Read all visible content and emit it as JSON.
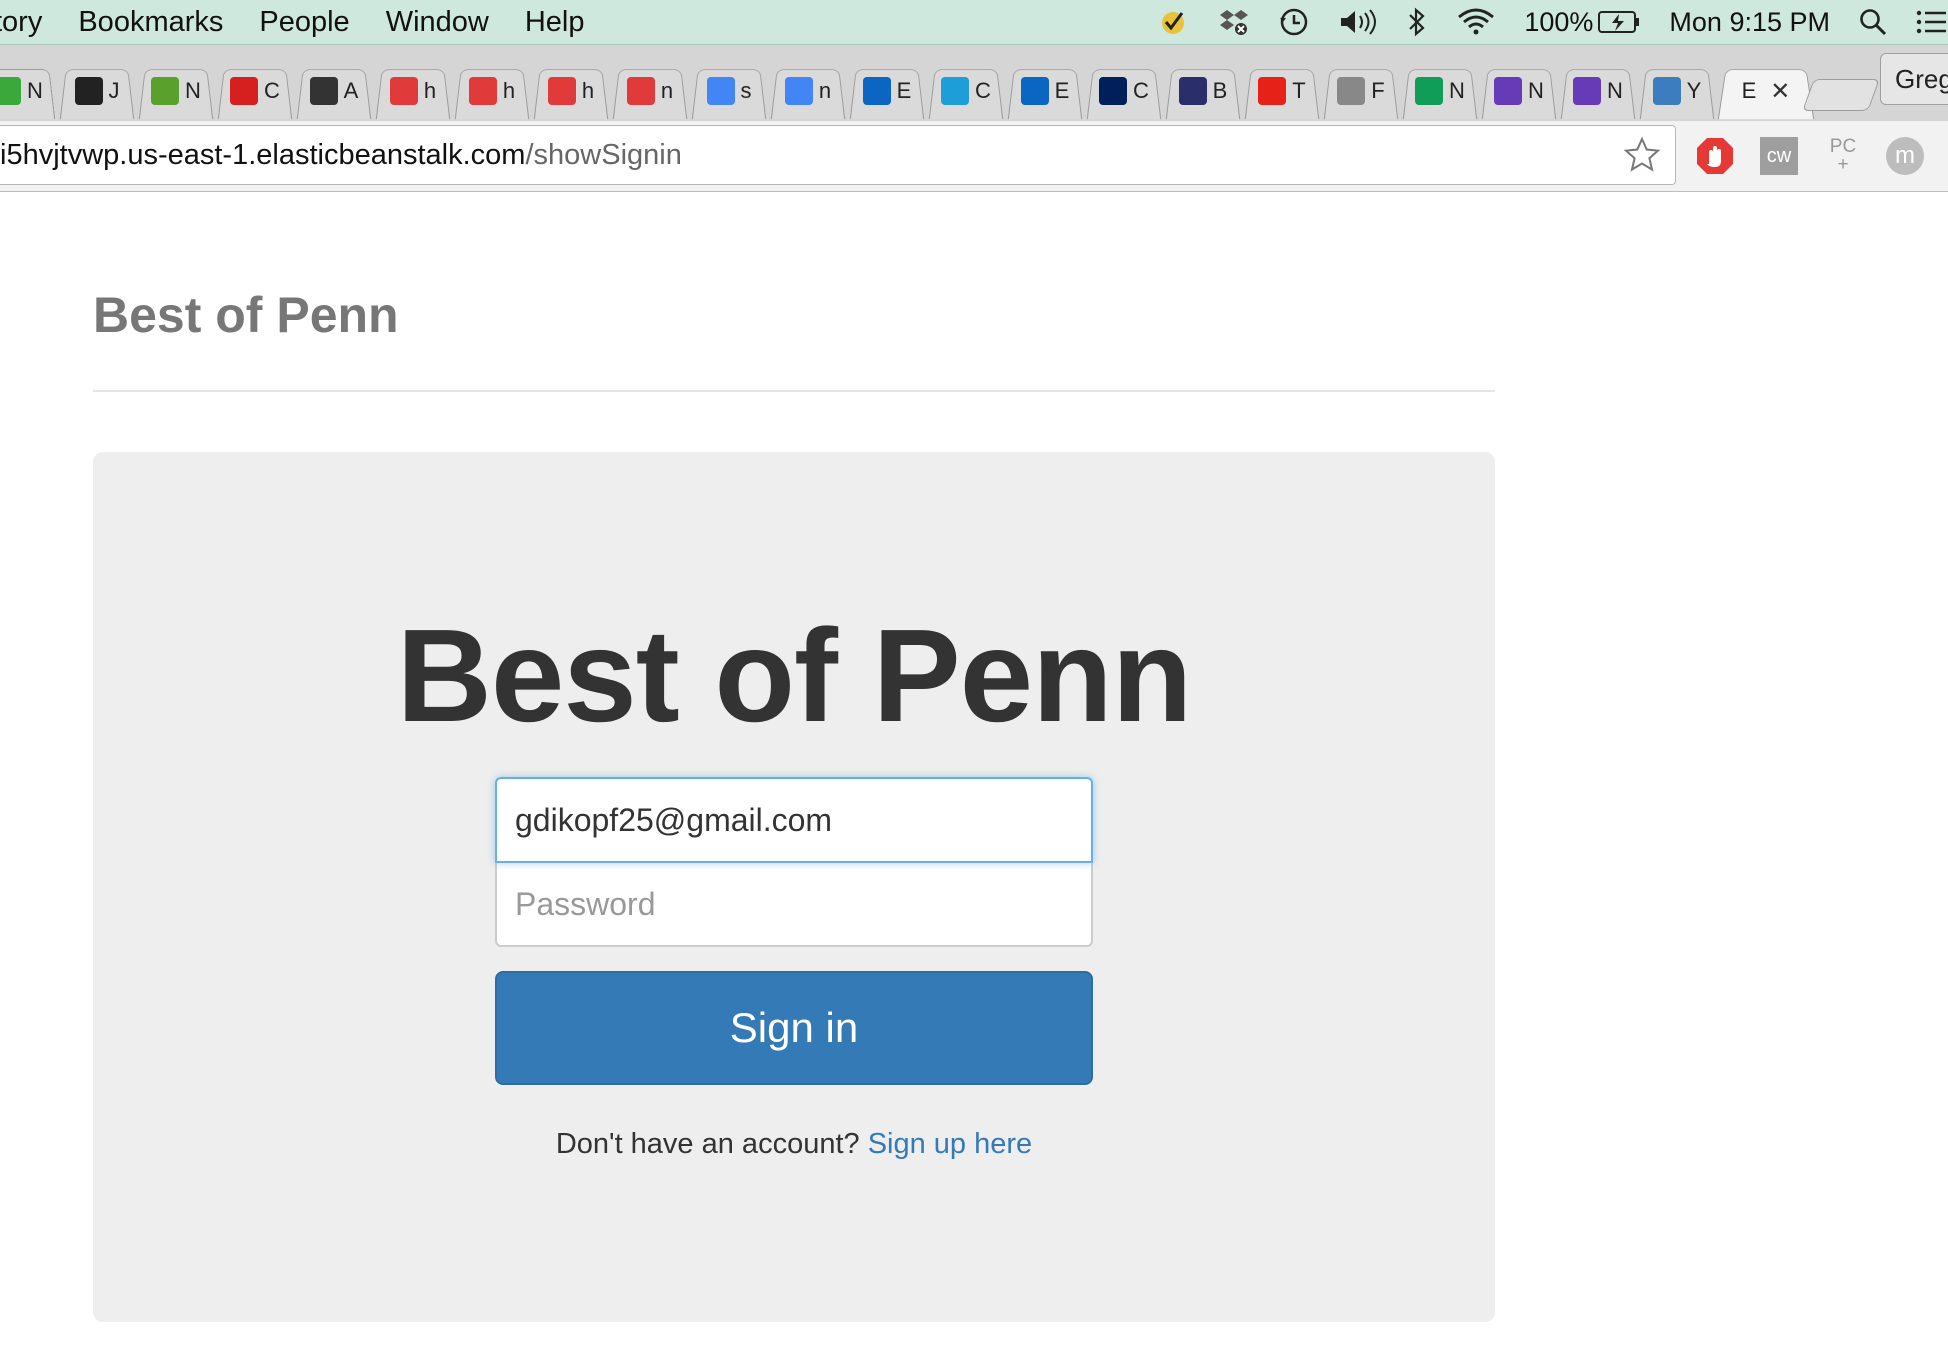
{
  "menubar": {
    "items": [
      "tory",
      "Bookmarks",
      "People",
      "Window",
      "Help"
    ],
    "battery": "100%",
    "clock": "Mon 9:15 PM"
  },
  "tabs": [
    {
      "icon": "evernote-icon",
      "label": "N",
      "color": "#3aa83a"
    },
    {
      "icon": "journal-icon",
      "label": "J",
      "color": "#222222"
    },
    {
      "icon": "location-pin-icon",
      "label": "N",
      "color": "#5aa02c"
    },
    {
      "icon": "info-icon",
      "label": "C",
      "color": "#d62020"
    },
    {
      "icon": "angellist-icon",
      "label": "A",
      "color": "#333333"
    },
    {
      "icon": "canvas-icon",
      "label": "h",
      "color": "#e03a3a"
    },
    {
      "icon": "canvas-icon",
      "label": "h",
      "color": "#e03a3a"
    },
    {
      "icon": "canvas-icon",
      "label": "h",
      "color": "#e03a3a"
    },
    {
      "icon": "canvas-icon",
      "label": "n",
      "color": "#e03a3a"
    },
    {
      "icon": "google-icon",
      "label": "s",
      "color": "#4285f4"
    },
    {
      "icon": "google-icon",
      "label": "n",
      "color": "#4285f4"
    },
    {
      "icon": "linkedin-icon",
      "label": "E",
      "color": "#0a66c2"
    },
    {
      "icon": "code-icon",
      "label": "C",
      "color": "#1e9ed8"
    },
    {
      "icon": "linkedin-icon",
      "label": "E",
      "color": "#0a66c2"
    },
    {
      "icon": "penn-shield-icon",
      "label": "C",
      "color": "#011f5b"
    },
    {
      "icon": "bottle-icon",
      "label": "B",
      "color": "#2a2f6b"
    },
    {
      "icon": "youtube-icon",
      "label": "T",
      "color": "#e62117"
    },
    {
      "icon": "document-icon",
      "label": "F",
      "color": "#888888"
    },
    {
      "icon": "sheets-icon",
      "label": "N",
      "color": "#0f9d58"
    },
    {
      "icon": "forms-icon",
      "label": "N",
      "color": "#673ab7"
    },
    {
      "icon": "forms-icon",
      "label": "N",
      "color": "#673ab7"
    },
    {
      "icon": "cloud-icon",
      "label": "Y",
      "color": "#3b7dbf"
    },
    {
      "icon": "",
      "label": "E",
      "color": "",
      "active": true,
      "close": "✕"
    }
  ],
  "profile_name": "Greg",
  "url": {
    "host": "i5hvjtvwp.us-east-1.elasticbeanstalk.com",
    "path": "/showSignin"
  },
  "extensions": [
    {
      "icon": "adblock-icon",
      "label": ""
    },
    {
      "icon": "cw-icon",
      "label": "cw"
    },
    {
      "icon": "pc-plus-icon",
      "label": "PC"
    },
    {
      "icon": "m-avatar-icon",
      "label": "m"
    }
  ],
  "page": {
    "header_title": "Best of Penn",
    "jumbo_title": "Best of Penn",
    "email_value": "gdikopf25@gmail.com",
    "password_placeholder": "Password",
    "signin_label": "Sign in",
    "signup_prompt": "Don't have an account?",
    "signup_link": "Sign up here"
  },
  "colors": {
    "menubar_bg": "#cfe8dd",
    "primary": "#337ab7",
    "jumbotron_bg": "#eeeeee"
  }
}
